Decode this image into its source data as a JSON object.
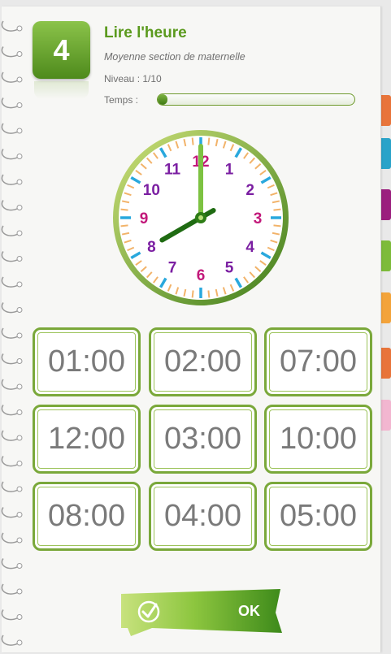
{
  "header": {
    "level_number": "4",
    "title": "Lire l'heure",
    "subtitle": "Moyenne section de maternelle",
    "level": "Niveau : 1/10",
    "time_label": "Temps :",
    "time_progress": 0.05,
    "accent": "#5b9a1e"
  },
  "clock": {
    "numbers": [
      "12",
      "1",
      "2",
      "3",
      "4",
      "5",
      "6",
      "7",
      "8",
      "9",
      "10",
      "11"
    ],
    "number_colors": [
      "#c2187a",
      "#7b1fa2",
      "#7b1fa2",
      "#c2187a",
      "#7b1fa2",
      "#7b1fa2",
      "#c2187a",
      "#7b1fa2",
      "#7b1fa2",
      "#c2187a",
      "#7b1fa2",
      "#7b1fa2"
    ],
    "hour": 8,
    "minute": 0
  },
  "answers": [
    "01:00",
    "02:00",
    "07:00",
    "12:00",
    "03:00",
    "10:00",
    "08:00",
    "04:00",
    "05:00"
  ],
  "ok": {
    "label": "OK",
    "check_icon": "check-circle-icon"
  },
  "side_tabs": [
    "#e8743a",
    "#2aa3c9",
    "#9b1f7e",
    "#7dbb3a",
    "#f3a33a",
    "#e8743a",
    "#f2b6d0"
  ]
}
